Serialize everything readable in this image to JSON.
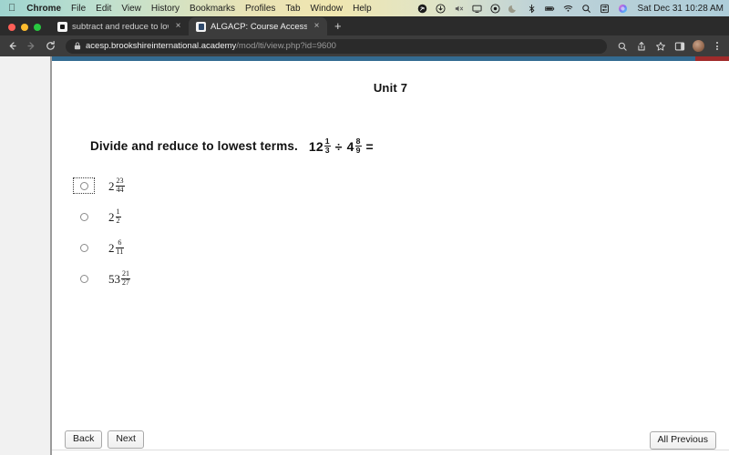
{
  "menubar": {
    "apple": "",
    "items": [
      {
        "label": "Chrome",
        "bold": true
      },
      {
        "label": "File",
        "bold": false
      },
      {
        "label": "Edit",
        "bold": false
      },
      {
        "label": "View",
        "bold": false
      },
      {
        "label": "History",
        "bold": false
      },
      {
        "label": "Bookmarks",
        "bold": false
      },
      {
        "label": "Profiles",
        "bold": false
      },
      {
        "label": "Tab",
        "bold": false
      },
      {
        "label": "Window",
        "bold": false
      },
      {
        "label": "Help",
        "bold": false
      }
    ],
    "status_icons": [
      "shazam-icon",
      "download-icon",
      "mute-icon",
      "display-icon",
      "control-icon",
      "moon-icon",
      "bluetooth-icon",
      "battery-icon",
      "wifi-icon",
      "spotlight-search-icon",
      "control-center-icon",
      "siri-icon"
    ],
    "clock": "Sat Dec 31  10:28 AM"
  },
  "browser": {
    "tabs": [
      {
        "title": "subtract and reduce to lowest t",
        "active": false,
        "favicon": "sq"
      },
      {
        "title": "ALGACP: Course Access",
        "active": true,
        "favicon": "doc"
      }
    ],
    "new_tab_label": "+",
    "close_label": "×",
    "toolbar": {
      "back_icon": "back-arrow-icon",
      "forward_icon": "forward-arrow-icon",
      "reload_icon": "reload-icon",
      "lock_icon": "lock-icon",
      "url_host": "acesp.brookshireinternational.academy",
      "url_path": "/mod/lti/view.php?id=9600",
      "search_icon": "search-icon",
      "share_icon": "share-icon",
      "bookmark_icon": "star-icon",
      "sidepanel_icon": "side-panel-icon",
      "avatar": "profile-avatar",
      "menu_icon": "three-dot-menu-icon"
    }
  },
  "page": {
    "accent_blue": "#336b91",
    "accent_red": "#a02b2b",
    "unit_title": "Unit 7",
    "question": {
      "prompt": "Divide and reduce to lowest terms.",
      "expression": {
        "left": {
          "whole": "12",
          "num": "1",
          "den": "3"
        },
        "operator": "÷",
        "right": {
          "whole": "4",
          "num": "8",
          "den": "9"
        },
        "equals": "="
      }
    },
    "options": [
      {
        "whole": "2",
        "num": "23",
        "den": "44",
        "selected": false,
        "focused": true
      },
      {
        "whole": "2",
        "num": "1",
        "den": "2",
        "selected": false,
        "focused": false
      },
      {
        "whole": "2",
        "num": "6",
        "den": "11",
        "selected": false,
        "focused": false
      },
      {
        "whole": "53",
        "num": "21",
        "den": "27",
        "selected": false,
        "focused": false
      }
    ],
    "footer": {
      "back_label": "Back",
      "next_label": "Next",
      "all_previous_label": "All Previous"
    }
  }
}
